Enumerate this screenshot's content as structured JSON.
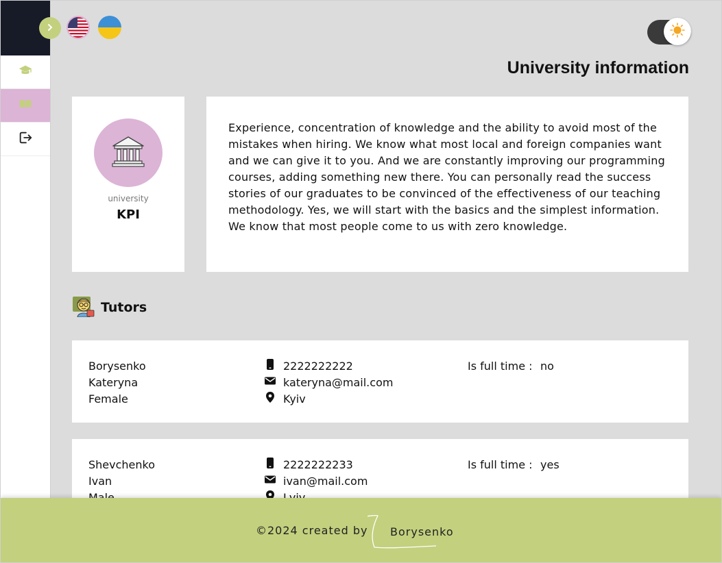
{
  "header": {
    "title": "University information"
  },
  "sidebar": {
    "items": [
      {
        "icon": "graduation-cap-icon"
      },
      {
        "icon": "open-book-icon"
      },
      {
        "icon": "logout-icon"
      }
    ]
  },
  "languages": [
    {
      "icon": "us-flag-icon"
    },
    {
      "icon": "ukraine-flag-icon"
    }
  ],
  "university": {
    "subtitle": "university",
    "name": "KPI",
    "description": "Experience, concentration of knowledge and the ability to avoid most of the mistakes when hiring. We know what most local and foreign companies want and we can give it to you. And we are constantly improving our programming courses, adding something new there. You can personally read the success stories of our graduates to be convinced of the effectiveness of our teaching methodology. Yes, we will start with the basics and the simplest information. We know that most people come to us with zero knowledge."
  },
  "tutors": {
    "title": "Tutors",
    "full_time_label": "Is full time :",
    "items": [
      {
        "last_name": "Borysenko",
        "first_name": "Kateryna",
        "gender": "Female",
        "phone": "2222222222",
        "email": "kateryna@mail.com",
        "city": "Kyiv",
        "full_time": "no"
      },
      {
        "last_name": "Shevchenko",
        "first_name": "Ivan",
        "gender": "Male",
        "phone": "2222222233",
        "email": "ivan@mail.com",
        "city": "Lviv",
        "full_time": "yes"
      }
    ]
  },
  "footer": {
    "copyright": "©2024 created by",
    "author": "Borysenko"
  },
  "colors": {
    "accent": "#c3d07e",
    "highlight": "#dcb4d6",
    "dark": "#171a27"
  }
}
